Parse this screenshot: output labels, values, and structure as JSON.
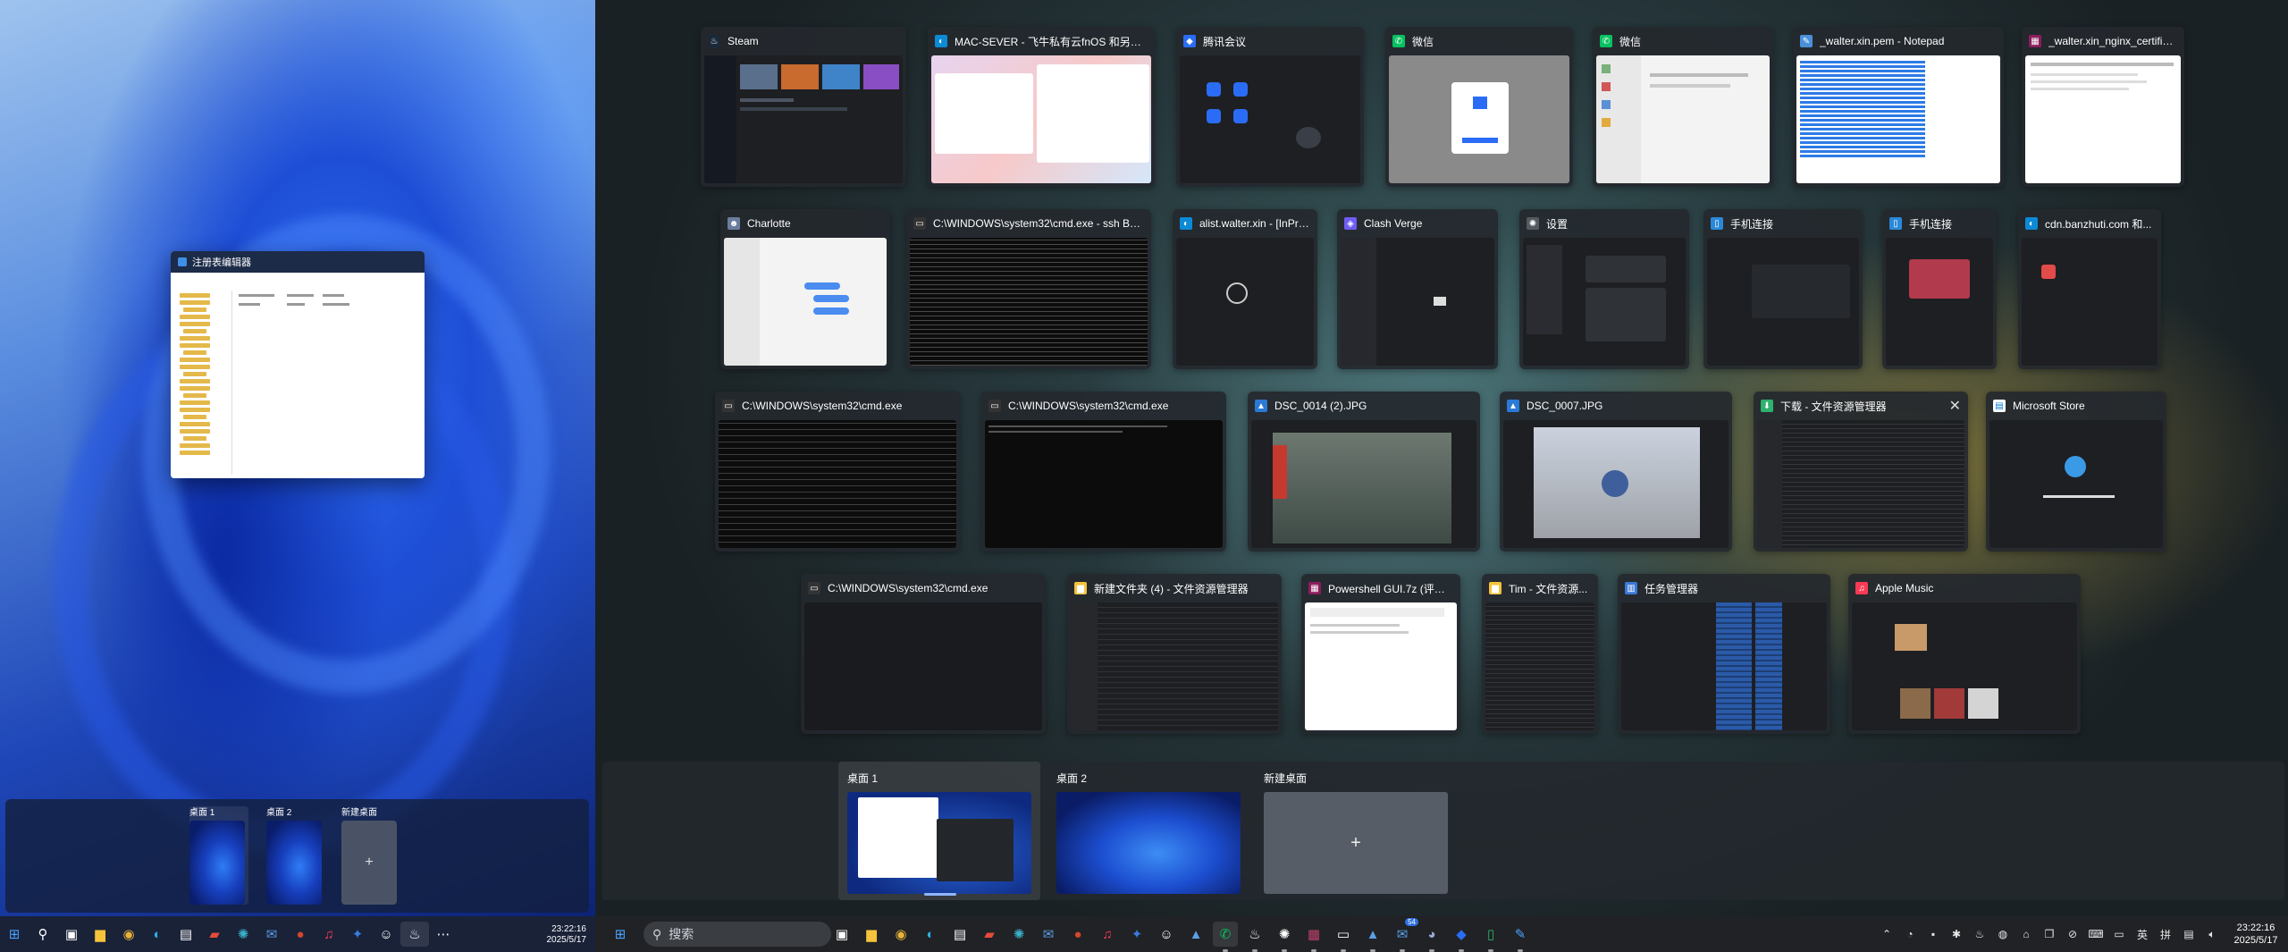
{
  "left_monitor": {
    "regedit_window": {
      "title": "注册表编辑器"
    },
    "virtual_desktops": [
      {
        "label": "桌面 1",
        "active": true
      },
      {
        "label": "桌面 2",
        "active": false
      },
      {
        "label": "新建桌面",
        "icon": "plus"
      }
    ],
    "clock": {
      "time": "23:22:16",
      "date": "2025/5/17"
    },
    "taskbar_icons": [
      "windows-start-icon",
      "search-icon",
      "task-view-icon",
      "file-explorer-icon",
      "chrome-icon",
      "edge-icon",
      "store-icon",
      "game-icon",
      "settings-gear-icon",
      "mail-icon",
      "powerpoint-icon",
      "music-icon",
      "mail-app-icon",
      "contact-icon",
      "steam-icon",
      "more-icon"
    ]
  },
  "task_view": {
    "rows": [
      [
        {
          "title": "Steam",
          "icon": "steam-icon",
          "icon_color": "#1b2838",
          "preview": "dark"
        },
        {
          "title": "MAC-SEVER - 飞牛私有云fnOS 和另外 46...",
          "icon": "edge-icon",
          "icon_color": "#0c8ad6",
          "preview": "light"
        },
        {
          "title": "腾讯会议",
          "icon": "tencent-meeting-icon",
          "icon_color": "#2b6cf6",
          "preview": "dark"
        },
        {
          "title": "微信",
          "icon": "wechat-icon",
          "icon_color": "#07c160",
          "preview": "light"
        },
        {
          "title": "微信",
          "icon": "wechat-icon",
          "icon_color": "#07c160",
          "preview": "light"
        },
        {
          "title": "_walter.xin.pem - Notepad",
          "icon": "notepad-icon",
          "icon_color": "#4a90d9",
          "preview": "notepad"
        },
        {
          "title": "_walter.xin_nginx_certifica...",
          "icon": "winrar-icon",
          "icon_color": "#8b1d5c",
          "preview": "light"
        }
      ],
      [
        {
          "title": "Charlotte",
          "icon": "charlotte-icon",
          "icon_color": "#6b7d9c",
          "preview": "light"
        },
        {
          "title": "C:\\WINDOWS\\system32\\cmd.exe - ssh  BGAT...",
          "icon": "cmd-icon",
          "icon_color": "#333333",
          "preview": "cmd"
        },
        {
          "title": "alist.walter.xin - [InPriv...",
          "icon": "edge-icon",
          "icon_color": "#0c8ad6",
          "preview": "dark"
        },
        {
          "title": "Clash Verge",
          "icon": "clash-verge-icon",
          "icon_color": "#6f5cf1",
          "preview": "dark"
        },
        {
          "title": "设置",
          "icon": "settings-gear-icon",
          "icon_color": "#555a61",
          "preview": "dark"
        },
        {
          "title": "手机连接",
          "icon": "phone-link-icon",
          "icon_color": "#2b88d8",
          "preview": "dark"
        },
        {
          "title": "手机连接",
          "icon": "phone-link-icon",
          "icon_color": "#2b88d8",
          "preview": "dark"
        },
        {
          "title": "cdn.banzhuti.com 和...",
          "icon": "edge-icon",
          "icon_color": "#0c8ad6",
          "preview": "dark"
        }
      ],
      [
        {
          "title": "C:\\WINDOWS\\system32\\cmd.exe",
          "icon": "cmd-icon",
          "icon_color": "#333333",
          "preview": "cmd"
        },
        {
          "title": "C:\\WINDOWS\\system32\\cmd.exe",
          "icon": "cmd-icon",
          "icon_color": "#333333",
          "preview": "cmd"
        },
        {
          "title": "DSC_0014 (2).JPG",
          "icon": "photos-icon",
          "icon_color": "#2a7ad6",
          "preview": "photo"
        },
        {
          "title": "DSC_0007.JPG",
          "icon": "photos-icon",
          "icon_color": "#2a7ad6",
          "preview": "photo2"
        },
        {
          "title": "下载 - 文件资源管理器",
          "icon": "download-icon",
          "icon_color": "#2fb26e",
          "preview": "dark",
          "closable": true
        },
        {
          "title": "Microsoft Store",
          "icon": "store-icon",
          "icon_color": "#ffffff",
          "preview": "dark"
        }
      ],
      [
        {
          "title": "C:\\WINDOWS\\system32\\cmd.exe",
          "icon": "cmd-icon",
          "icon_color": "#333333",
          "preview": "dark"
        },
        {
          "title": "新建文件夹 (4) - 文件资源管理器",
          "icon": "folder-icon",
          "icon_color": "#f5c33b",
          "preview": "dark"
        },
        {
          "title": "Powershell GUI.7z (评估版...",
          "icon": "winrar-icon",
          "icon_color": "#8b1d5c",
          "preview": "light"
        },
        {
          "title": "Tim - 文件资源...",
          "icon": "folder-icon",
          "icon_color": "#f5c33b",
          "preview": "dark"
        },
        {
          "title": "任务管理器",
          "icon": "task-manager-icon",
          "icon_color": "#3a78d4",
          "preview": "dark"
        },
        {
          "title": "Apple Music",
          "icon": "apple-music-icon",
          "icon_color": "#fa3a55",
          "preview": "dark"
        }
      ]
    ],
    "virtual_desktops": [
      {
        "label": "桌面 1",
        "active": true
      },
      {
        "label": "桌面 2",
        "active": false
      },
      {
        "label": "新建桌面",
        "icon": "plus"
      }
    ]
  },
  "taskbar": {
    "search_placeholder": "搜索",
    "pinned": [
      "file-explorer-icon",
      "chrome-icon",
      "edge-icon",
      "store-icon",
      "game-icon",
      "settings-gear-icon",
      "mail-icon",
      "powerpoint-icon",
      "music-icon",
      "mail-app-icon",
      "contact-icon",
      "photos-icon",
      "wechat-icon",
      "steam-icon",
      "settings-gear-icon",
      "winrar-icon",
      "cmd-icon",
      "photos-icon",
      "chat-icon",
      "game-icon",
      "tencent-meeting-icon",
      "phone-link-icon",
      "notepad-icon"
    ],
    "badge_count": "54",
    "tray": {
      "ime_en": "英",
      "ime_cn": "拼"
    },
    "clock": {
      "time": "23:22:16",
      "date": "2025/5/17"
    }
  }
}
